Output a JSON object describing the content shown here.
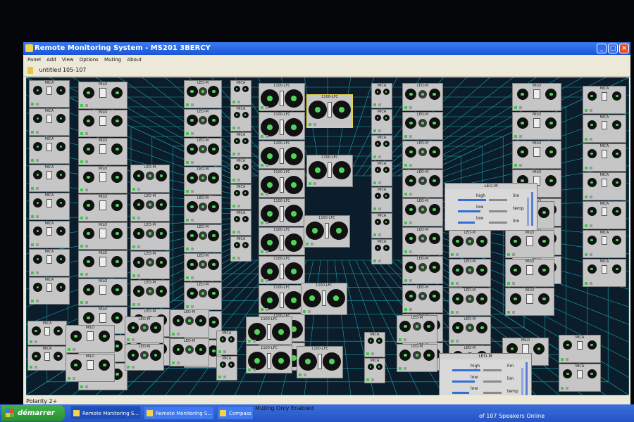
{
  "window": {
    "title": "Remote Monitoring System - MS201 3BERCY",
    "minimize_label": "_",
    "maximize_label": "□",
    "close_label": "×"
  },
  "menu": [
    "Panel",
    "Add",
    "View",
    "Options",
    "Muting",
    "About"
  ],
  "toolbar": {
    "file_label": "untitled  105-107"
  },
  "polarity": {
    "text": "Polarity  2+"
  },
  "status": {
    "muting": "Muting Only Enabled",
    "speakers": "of 107 Speakers Online"
  },
  "taskbar": {
    "start_label": "démarrer",
    "tasks": [
      "Remote Monitoring S...",
      "Remote Monitoring S...",
      "Compass - Main Wind..."
    ]
  },
  "module_labels": {
    "mica": "MICA",
    "milo": "MILO",
    "leo": "LEO-M",
    "lfc": "1100-LFC",
    "melo": "MELO"
  },
  "panels": [
    {
      "title": "LEO-M",
      "rows": [
        "high",
        "low",
        "low"
      ],
      "side": [
        "lim",
        "temp",
        "lim"
      ]
    },
    {
      "title": "LEO-M",
      "rows": [
        "high",
        "low",
        "low"
      ],
      "side": [
        "lim",
        "lim",
        "temp"
      ]
    }
  ],
  "colors": {
    "grid": "#1aa7b0",
    "speaker_cone": "#4cd65a",
    "module": "#c6c6c6",
    "titlebar": "#2a62e0"
  }
}
